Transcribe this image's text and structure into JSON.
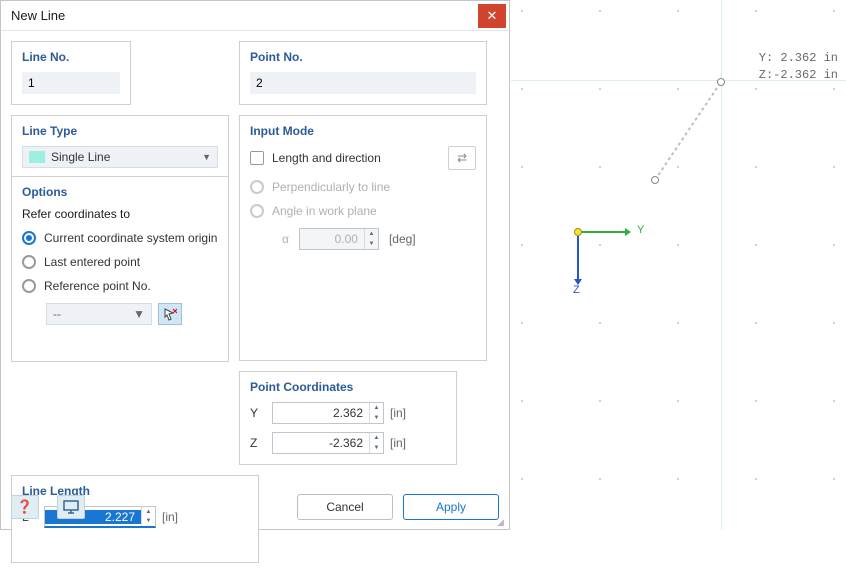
{
  "dialog": {
    "title": "New Line",
    "line_no": {
      "label": "Line No.",
      "value": "1"
    },
    "point_no": {
      "label": "Point No.",
      "value": "2"
    },
    "line_type": {
      "label": "Line Type",
      "value": "Single Line"
    },
    "options": {
      "label": "Options",
      "refer_label": "Refer coordinates to",
      "opt_origin": "Current coordinate system origin",
      "opt_last": "Last entered point",
      "opt_refpt": "Reference point No.",
      "ref_placeholder": "--"
    },
    "input_mode": {
      "label": "Input Mode",
      "length_dir": "Length and direction",
      "perp": "Perpendicularly to line",
      "angle_plane": "Angle in work plane",
      "alpha": "α",
      "alpha_val": "0.00",
      "alpha_unit": "[deg]"
    },
    "coords": {
      "label": "Point Coordinates",
      "y_label": "Y",
      "y_val": "2.362",
      "z_label": "Z",
      "z_val": "-2.362",
      "unit": "[in]"
    },
    "length": {
      "label": "Line Length",
      "l_label": "L",
      "l_val": "2.227",
      "unit": "[in]"
    },
    "footer": {
      "cancel": "Cancel",
      "apply": "Apply"
    }
  },
  "canvas": {
    "readout_y": "Y: 2.362 in",
    "readout_z": "Z:-2.362 in",
    "axis_y": "Y",
    "axis_z": "Z"
  }
}
